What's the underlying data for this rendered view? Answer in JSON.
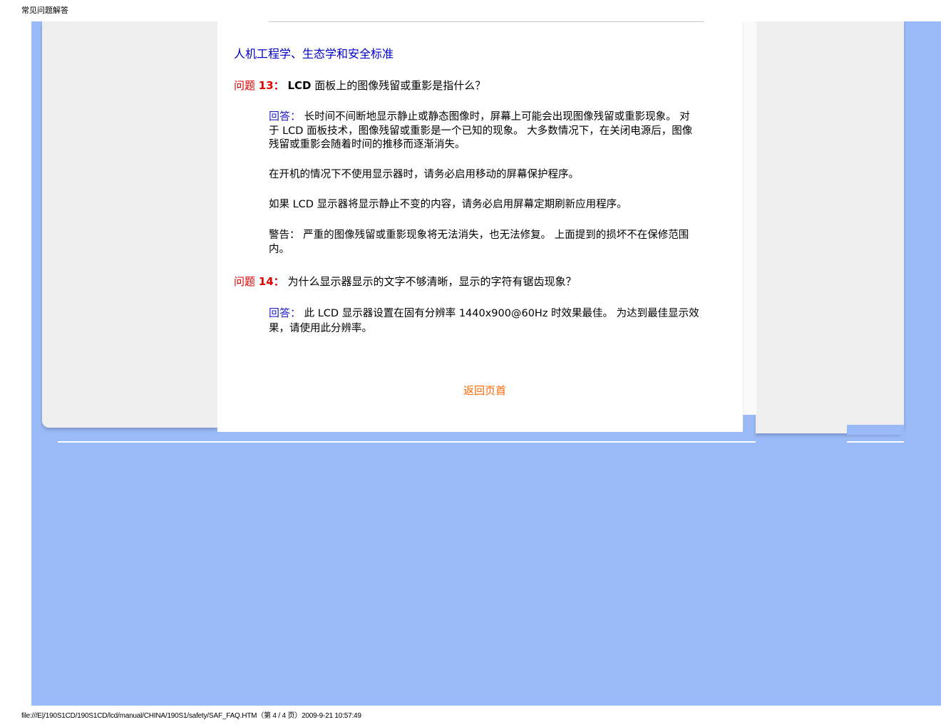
{
  "header": {
    "title": "常见问题解答"
  },
  "section": {
    "title": "人机工程学、生态学和安全标准"
  },
  "q13": {
    "label": "问题",
    "number": "13：",
    "title_bold": "LCD",
    "title_rest": " 面板上的图像残留或重影是指什么？",
    "answer_label": "回答：",
    "answer_text": " 长时间不间断地显示静止或静态图像时，屏幕上可能会出现图像残留或重影现象。 对于 LCD 面板技术，图像残留或重影是一个已知的现象。 大多数情况下，在关闭电源后，图像残留或重影会随着时间的推移而逐渐消失。",
    "para2": "在开机的情况下不使用显示器时，请务必启用移动的屏幕保护程序。",
    "para3": "如果 LCD 显示器将显示静止不变的内容，请务必启用屏幕定期刷新应用程序。",
    "para4": "警告： 严重的图像残留或重影现象将无法消失，也无法修复。 上面提到的损坏不在保修范围内。"
  },
  "q14": {
    "label": "问题",
    "number": "14：",
    "title": " 为什么显示器显示的文字不够清晰，显示的字符有锯齿现象？",
    "answer_label": "回答：",
    "answer_text": " 此 LCD 显示器设置在固有分辨率 1440x900@60Hz 时效果最佳。 为达到最佳显示效果，请使用此分辨率。"
  },
  "nav": {
    "back_to_top": "返回页首"
  },
  "footer": {
    "path": "file:///E|/190S1CD/190S1CD/lcd/manual/CHINA/190S1/safety/SAF_FAQ.HTM（第 4 / 4 页）2009-9-21 10:57:49"
  },
  "colors": {
    "background_blue": "#99b9f7",
    "panel_gray": "#efefef",
    "question_red": "#e00000",
    "answer_blue": "#2222cc",
    "link_orange": "#ff6600"
  }
}
